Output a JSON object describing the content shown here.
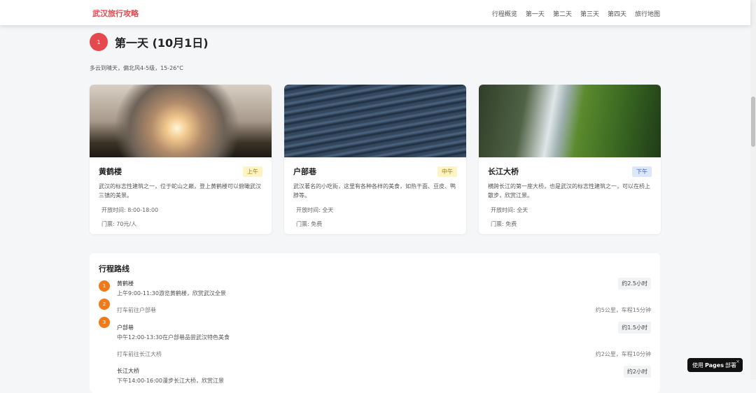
{
  "header": {
    "logo": "武汉旅行攻略",
    "nav": [
      "行程概览",
      "第一天",
      "第二天",
      "第三天",
      "第四天",
      "旅行地图"
    ]
  },
  "day": {
    "number": "1",
    "title": "第一天 (10月1日)",
    "weather": "多云到晴天，偏北风4-5级，15-26°C"
  },
  "cards": [
    {
      "name": "黄鹤楼",
      "badge": "上午",
      "desc": "武汉的标志性建筑之一，位于蛇山之巅，登上黄鹤楼可以俯瞰武汉三镇的美景。",
      "hours": "开放时间: 8:00-18:00",
      "ticket": "门票: 70元/人"
    },
    {
      "name": "户部巷",
      "badge": "中午",
      "desc": "武汉著名的小吃街，这里有各种各样的美食，如热干面、豆皮、鸭脖等。",
      "hours": "开放时间: 全天",
      "ticket": "门票: 免费"
    },
    {
      "name": "长江大桥",
      "badge": "下午",
      "desc": "横跨长江的第一座大桥，也是武汉的标志性建筑之一，可以在桥上散步，欣赏江景。",
      "hours": "开放时间: 全天",
      "ticket": "门票: 免费"
    }
  ],
  "route": {
    "title": "行程路线",
    "steps": [
      {
        "num": "1",
        "name": "黄鹤楼",
        "desc": "上午9:00-11:30游览黄鹤楼，欣赏武汉全景",
        "duration": "约2.5小时"
      },
      {
        "num": "2",
        "move": "打车前往户部巷",
        "distance": "约5公里，车程15分钟"
      },
      {
        "num": "3",
        "name": "户部巷",
        "desc": "中午12:00-13:30在户部巷品尝武汉特色美食",
        "duration": "约1.5小时"
      },
      {
        "move": "打车前往长江大桥",
        "distance": "约2公里，车程10分钟"
      },
      {
        "name": "长江大桥",
        "desc": "下午14:00-16:00漫步长江大桥，欣赏江景",
        "duration": "约2小时"
      }
    ]
  },
  "pages_badge": {
    "prefix": "使用",
    "brand": "Pages",
    "suffix": "部署",
    "close": "×"
  }
}
